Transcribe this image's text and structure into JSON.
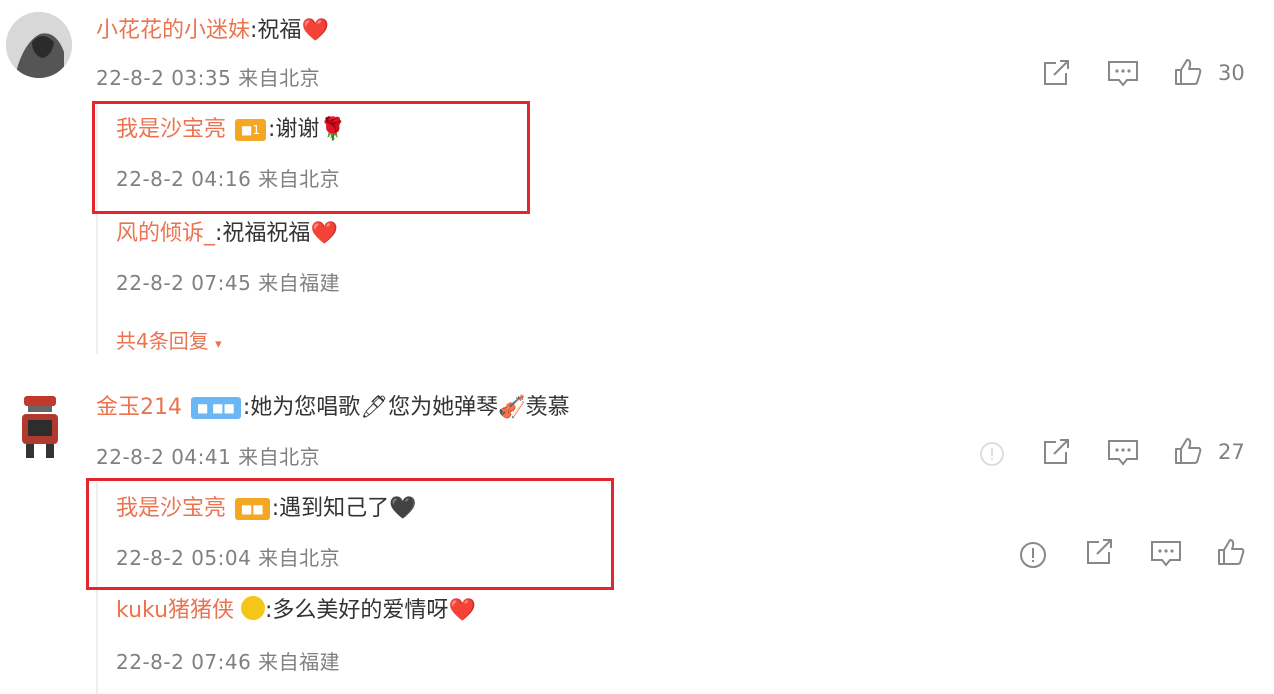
{
  "comments": [
    {
      "user": "小花花的小迷妹",
      "text": ":祝福",
      "emoji": "❤️",
      "meta": "22-8-2 03:35 来自北京",
      "likes": "30",
      "replies": [
        {
          "user": "我是沙宝亮",
          "badge": "■1",
          "text": ":谢谢",
          "emoji": "🌹",
          "meta": "22-8-2 04:16 来自北京"
        },
        {
          "user": "风的倾诉_",
          "text": ":祝福祝福",
          "emoji": "❤️",
          "meta": "22-8-2 07:45 来自福建"
        }
      ],
      "more": "共4条回复"
    },
    {
      "user": "金玉214",
      "badge": "■ ■■",
      "text": ":她为您唱歌🖊您为她弹琴🎻羡慕",
      "meta": "22-8-2 04:41 来自北京",
      "likes": "27",
      "replies": [
        {
          "user": "我是沙宝亮",
          "badge": "■■",
          "text": ":遇到知己了",
          "emoji": "🖤",
          "meta": "22-8-2 05:04 来自北京"
        },
        {
          "user": "kuku猪猪侠",
          "text": ":多么美好的爱情呀",
          "emoji": "❤️",
          "meta": "22-8-2 07:46 来自福建"
        }
      ]
    }
  ],
  "colors": {
    "username": "#eb7350",
    "meta": "#808080",
    "highlight": "#e3262e"
  },
  "icons": [
    "share-icon",
    "comment-icon",
    "like-icon",
    "report-icon"
  ]
}
